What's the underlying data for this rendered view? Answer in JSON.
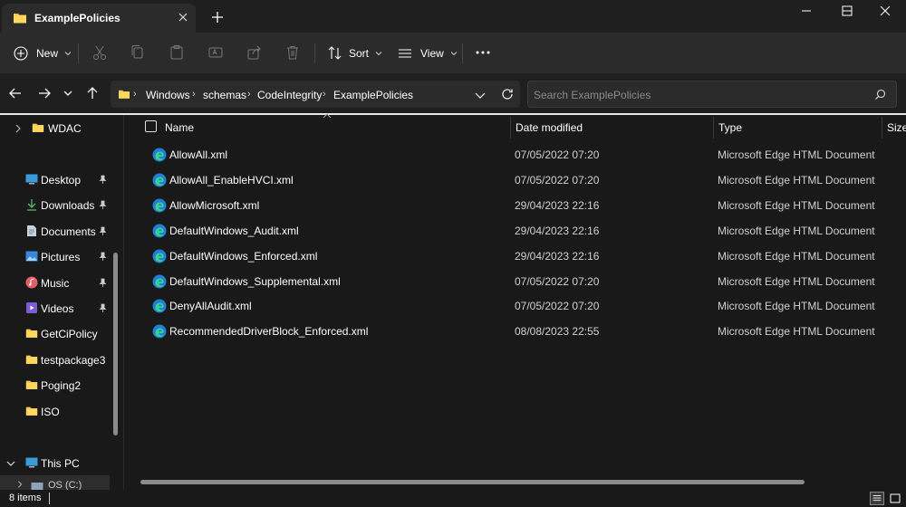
{
  "window": {
    "tab_title": "ExamplePolicies",
    "new_tab_icon": "plus-icon"
  },
  "toolbar": {
    "new_label": "New",
    "sort_label": "Sort",
    "view_label": "View",
    "more_icon": "ellipsis-icon"
  },
  "address": {
    "breadcrumbs": [
      "Windows",
      "schemas",
      "CodeIntegrity",
      "ExamplePolicies"
    ],
    "search_placeholder": "Search ExamplePolicies"
  },
  "sidebar": {
    "top_folder": "WDAC",
    "items": [
      {
        "label": "Desktop",
        "icon": "desktop-icon",
        "pinned": true
      },
      {
        "label": "Downloads",
        "icon": "download-icon",
        "pinned": true
      },
      {
        "label": "Documents",
        "icon": "document-icon",
        "pinned": true
      },
      {
        "label": "Pictures",
        "icon": "pictures-icon",
        "pinned": true
      },
      {
        "label": "Music",
        "icon": "music-icon",
        "pinned": true
      },
      {
        "label": "Videos",
        "icon": "videos-icon",
        "pinned": true
      },
      {
        "label": "GetCiPolicy",
        "icon": "folder-icon",
        "pinned": false
      },
      {
        "label": "testpackage3",
        "icon": "folder-icon",
        "pinned": false
      },
      {
        "label": "Poging2",
        "icon": "folder-icon",
        "pinned": false
      },
      {
        "label": "ISO",
        "icon": "folder-icon",
        "pinned": false
      }
    ],
    "this_pc": "This PC",
    "drive_partial": "OS (C:)"
  },
  "columns": {
    "name": "Name",
    "date": "Date modified",
    "type": "Type",
    "size": "Size"
  },
  "files": [
    {
      "name": "AllowAll.xml",
      "date": "07/05/2022 07:20",
      "type": "Microsoft Edge HTML Document"
    },
    {
      "name": "AllowAll_EnableHVCI.xml",
      "date": "07/05/2022 07:20",
      "type": "Microsoft Edge HTML Document"
    },
    {
      "name": "AllowMicrosoft.xml",
      "date": "29/04/2023 22:16",
      "type": "Microsoft Edge HTML Document"
    },
    {
      "name": "DefaultWindows_Audit.xml",
      "date": "29/04/2023 22:16",
      "type": "Microsoft Edge HTML Document"
    },
    {
      "name": "DefaultWindows_Enforced.xml",
      "date": "29/04/2023 22:16",
      "type": "Microsoft Edge HTML Document"
    },
    {
      "name": "DefaultWindows_Supplemental.xml",
      "date": "07/05/2022 07:20",
      "type": "Microsoft Edge HTML Document"
    },
    {
      "name": "DenyAllAudit.xml",
      "date": "07/05/2022 07:20",
      "type": "Microsoft Edge HTML Document"
    },
    {
      "name": "RecommendedDriverBlock_Enforced.xml",
      "date": "08/08/2023 22:55",
      "type": "Microsoft Edge HTML Document"
    }
  ],
  "status": {
    "item_count": "8 items"
  },
  "colors": {
    "folder": "#f4c542",
    "accent": "#4cc2ff",
    "background": "#191919"
  }
}
